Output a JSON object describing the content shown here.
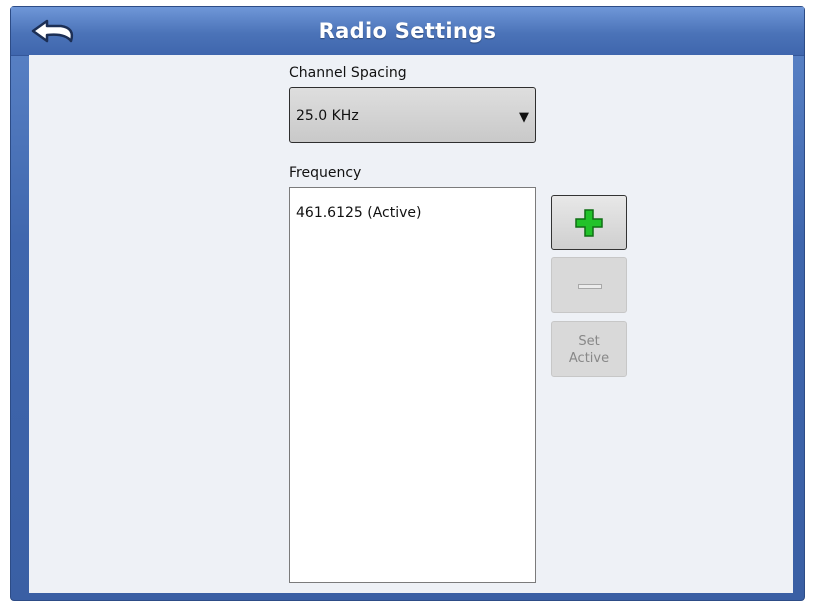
{
  "header": {
    "title": "Radio Settings",
    "back_icon": "back-arrow-icon"
  },
  "channel_spacing": {
    "label": "Channel Spacing",
    "selected": "25.0 KHz",
    "arrow": "▼"
  },
  "frequency": {
    "label": "Frequency",
    "items": [
      "461.6125 (Active)"
    ]
  },
  "buttons": {
    "add_icon": "plus-icon",
    "remove_icon": "minus-icon",
    "set_active_line1": "Set",
    "set_active_line2": "Active"
  },
  "colors": {
    "titlebar": "#4b73b8",
    "content_bg": "#eef1f6",
    "plus_green": "#22c22a"
  }
}
